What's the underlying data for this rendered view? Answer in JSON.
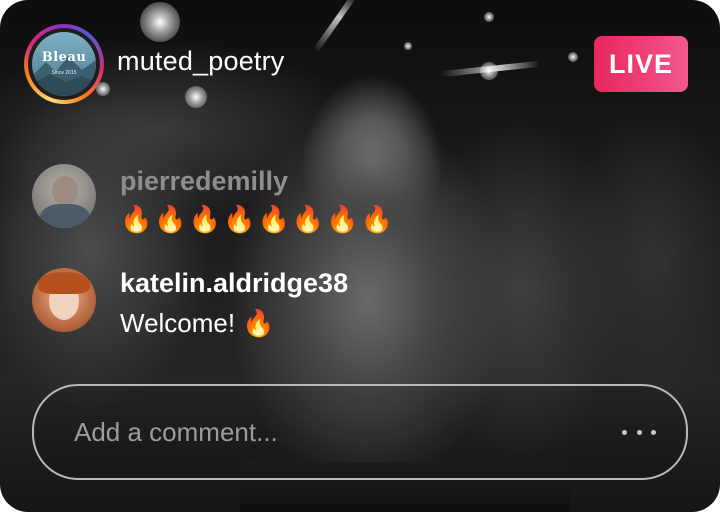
{
  "header": {
    "username": "muted_poetry",
    "avatar_logo_text": "Bleau",
    "avatar_logo_subtext": "Since 2015",
    "live_label": "LIVE",
    "live_color": "#ee3a72"
  },
  "comments": [
    {
      "username": "pierredemilly",
      "text": "🔥🔥🔥🔥🔥🔥🔥🔥",
      "username_color": "#8e8e8e"
    },
    {
      "username": "katelin.aldridge38",
      "text": "Welcome! 🔥",
      "username_color": "#ffffff"
    }
  ],
  "composer": {
    "placeholder": "Add a comment...",
    "more_icon": "more-horizontal-icon"
  }
}
